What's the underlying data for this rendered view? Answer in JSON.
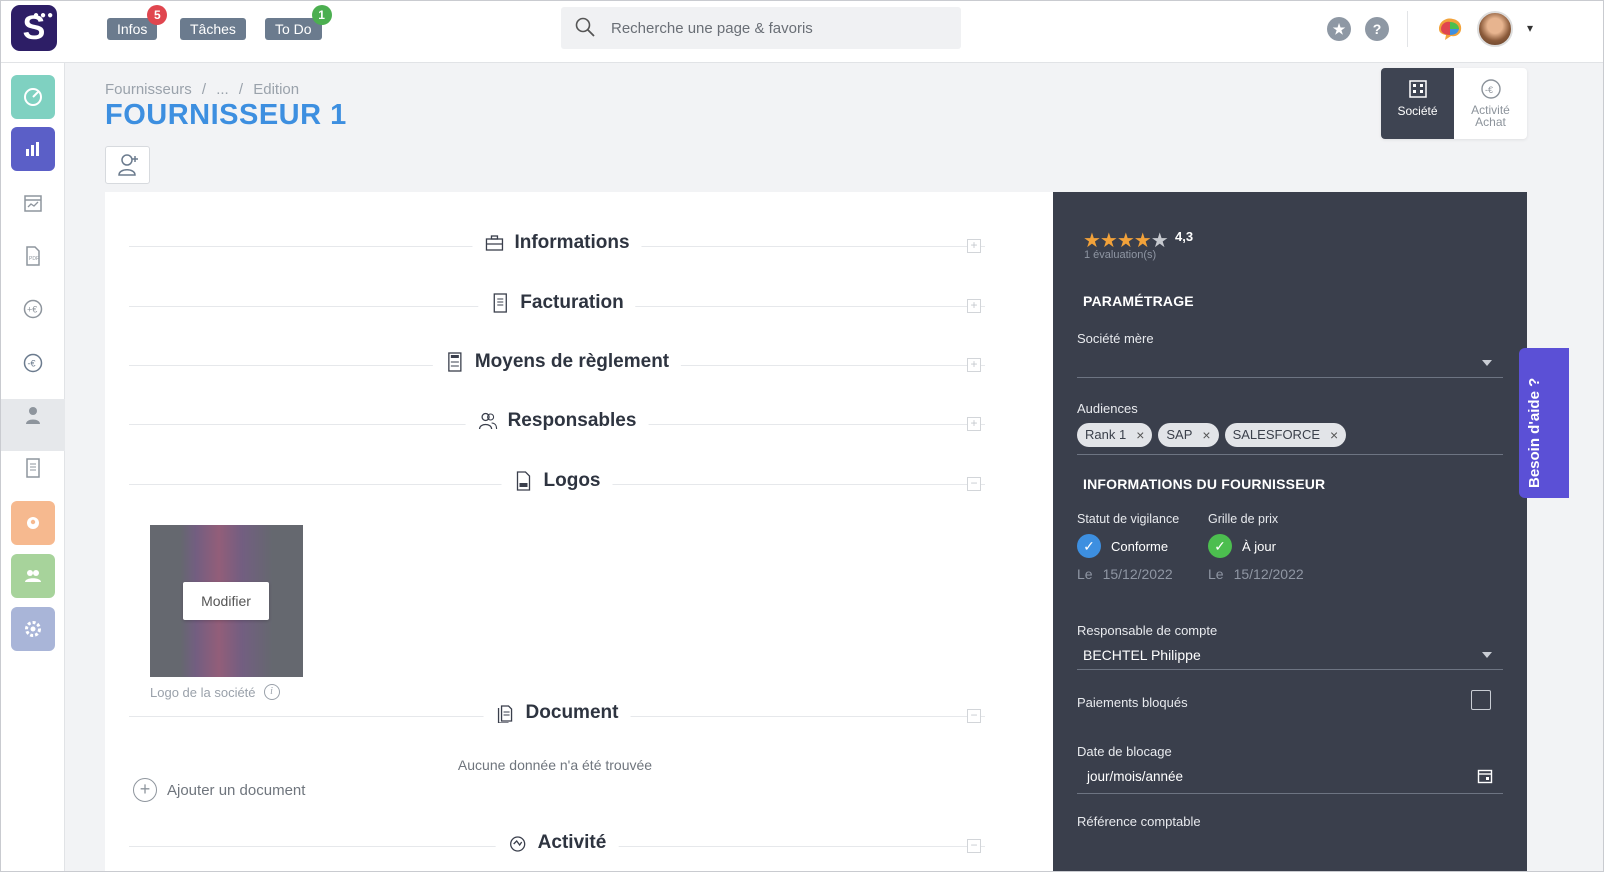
{
  "topbar": {
    "logo_letter": "S",
    "buttons": [
      {
        "label": "Infos",
        "badge": "5",
        "badge_color": "#e0464f"
      },
      {
        "label": "Tâches",
        "badge": null
      },
      {
        "label": "To Do",
        "badge": "1",
        "badge_color": "#4caf50"
      }
    ],
    "search_placeholder": "Recherche une page & favoris",
    "icons": [
      "star-icon",
      "help-icon",
      "brain-icon",
      "avatar",
      "chevron-down-icon"
    ],
    "help_glyph": "?",
    "dropdown_glyph": "▾"
  },
  "sidebar": {
    "items": [
      {
        "icon": "dashboard-icon",
        "color": "#7fd1c1"
      },
      {
        "icon": "bar-chart-icon",
        "color": "#5b5fc7"
      },
      {
        "icon": "calendar-chart-icon",
        "color": null
      },
      {
        "icon": "pdf-document-icon",
        "color": null
      },
      {
        "icon": "euro-in-icon",
        "color": null
      },
      {
        "icon": "euro-out-icon",
        "color": null,
        "active": true
      },
      {
        "icon": "user-tie-icon",
        "color": null
      },
      {
        "icon": "invoice-icon",
        "color": null
      },
      {
        "icon": "person-badge-icon",
        "color": "#f6b98f"
      },
      {
        "icon": "team-icon",
        "color": "#a7d39b"
      },
      {
        "icon": "settings-icon",
        "color": "#a9b5d8"
      }
    ]
  },
  "page": {
    "breadcrumb": [
      "Fournisseurs",
      "/",
      "...",
      "/",
      "Edition"
    ],
    "title": "FOURNISSEUR 1",
    "view_tabs": [
      {
        "label": "Société",
        "active": true
      },
      {
        "label": "Activité Achat",
        "active": false
      }
    ]
  },
  "sections": [
    {
      "label": "Informations",
      "icon": "briefcase-icon",
      "toggle": "+"
    },
    {
      "label": "Facturation",
      "icon": "invoice-icon",
      "toggle": "+"
    },
    {
      "label": "Moyens de règlement",
      "icon": "ledger-icon",
      "toggle": "+"
    },
    {
      "label": "Responsables",
      "icon": "people-icon",
      "toggle": "+"
    },
    {
      "label": "Logos",
      "icon": "image-file-icon",
      "toggle": "−"
    },
    {
      "label": "Document",
      "icon": "documents-icon",
      "toggle": "−"
    },
    {
      "label": "Activité",
      "icon": "activity-icon",
      "toggle": "−"
    }
  ],
  "logos": {
    "modify_label": "Modifier",
    "caption": "Logo de la société",
    "info_glyph": "i"
  },
  "documents": {
    "empty_text": "Aucune donnée n'a été trouvée",
    "add_label": "Ajouter un document",
    "add_glyph": "+"
  },
  "panel": {
    "stars_on": "★★★★",
    "stars_off": "★",
    "rating": "4,3",
    "evaluations": "1 évaluation(s)",
    "parametrage_title": "PARAMÉTRAGE",
    "societe_mere_label": "Société mère",
    "audiences_label": "Audiences",
    "audiences": [
      "Rank 1",
      "SAP",
      "SALESFORCE"
    ],
    "chip_remove_glyph": "×",
    "info_fournisseur_title": "INFORMATIONS DU FOURNISSEUR",
    "statut_vigilance": {
      "label": "Statut de vigilance",
      "value": "Conforme",
      "le": "Le",
      "date": "15/12/2022",
      "color": "#3d8fe0"
    },
    "grille_prix": {
      "label": "Grille de prix",
      "value": "À jour",
      "le": "Le",
      "date": "15/12/2022",
      "color": "#4cbe4f"
    },
    "check_glyph": "✓",
    "responsable_label": "Responsable de compte",
    "responsable_value": "BECHTEL Philippe",
    "paiements_label": "Paiements bloqués",
    "paiements_checked": false,
    "date_blocage_label": "Date de blocage",
    "date_blocage_placeholder": "jour/mois/année",
    "reference_label": "Référence comptable"
  },
  "help_tab": "Besoin d'aide ?"
}
